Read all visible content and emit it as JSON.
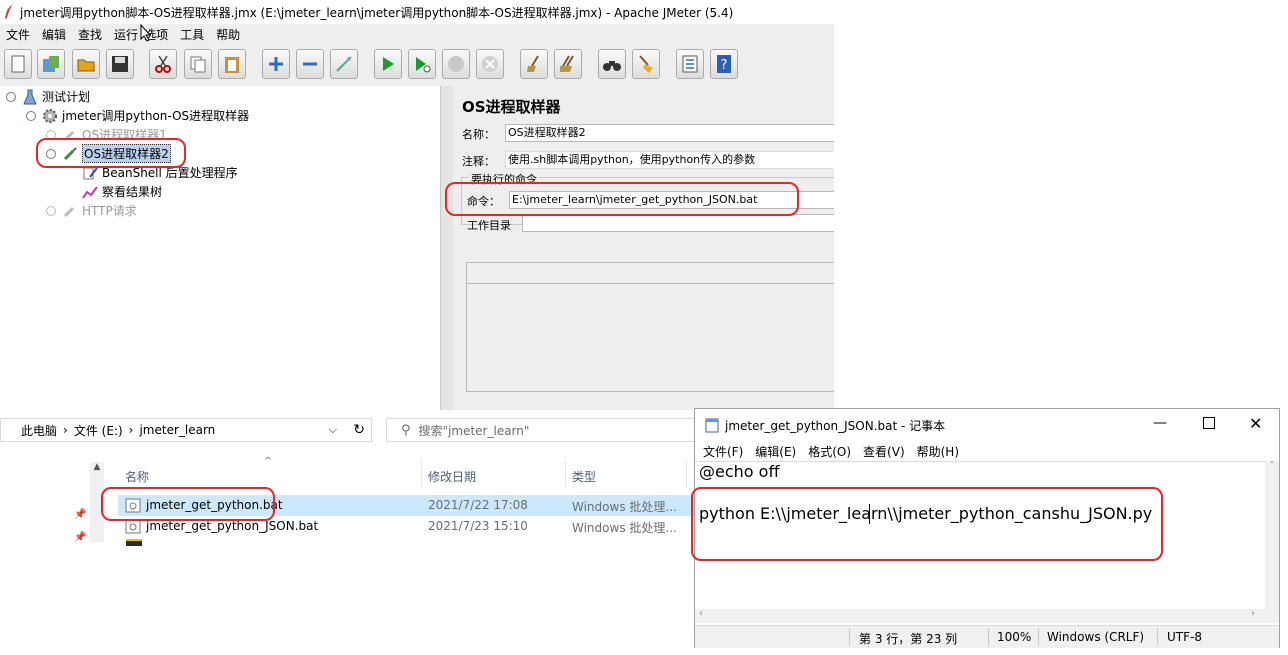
{
  "jmeter": {
    "title": "jmeter调用python脚本-OS进程取样器.jmx (E:\\jmeter_learn\\jmeter调用python脚本-OS进程取样器.jmx) - Apache JMeter (5.4)",
    "menu": [
      "文件",
      "编辑",
      "查找",
      "运行",
      "选项",
      "工具",
      "帮助"
    ],
    "tree": {
      "test_plan": "测试计划",
      "thread_group": "jmeter调用python-OS进程取样器",
      "os_sampler_1": "OS进程取样器1",
      "os_sampler_2": "OS进程取样器2",
      "beanshell": "BeanShell 后置处理程序",
      "result_tree": "察看结果树",
      "http": "HTTP请求"
    },
    "panel": {
      "heading": "OS进程取样器",
      "name_label": "名称：",
      "name_value": "OS进程取样器2",
      "comment_label": "注释：",
      "comment_value": "使用.sh脚本调用python，使用python传入的参数",
      "section_label": "要执行的命令",
      "command_label": "命令：",
      "command_value": "E:\\jmeter_learn\\jmeter_get_python_JSON.bat",
      "workdir_label": "工作目录",
      "workdir_value": ""
    }
  },
  "explorer": {
    "breadcrumb": [
      "此电脑",
      "文件 (E:)",
      "jmeter_learn"
    ],
    "search_placeholder": "搜索\"jmeter_learn\"",
    "columns": {
      "name": "名称",
      "modified": "修改日期",
      "type": "类型"
    },
    "files": [
      {
        "name": "jmeter_get_python.bat",
        "modified": "2021/7/22 17:08",
        "type": "Windows 批处理..."
      },
      {
        "name": "jmeter_get_python_JSON.bat",
        "modified": "2021/7/23 15:10",
        "type": "Windows 批处理..."
      }
    ]
  },
  "notepad": {
    "title": "jmeter_get_python_JSON.bat - 记事本",
    "menu": [
      "文件(F)",
      "编辑(E)",
      "格式(O)",
      "查看(V)",
      "帮助(H)"
    ],
    "lines": [
      "@echo off",
      "",
      "python E:\\\\jmeter_learn\\\\jmeter_python_canshu_JSON.py"
    ],
    "status": {
      "position": "第 3 行，第 23 列",
      "zoom": "100%",
      "eol": "Windows (CRLF)",
      "encoding": "UTF-8"
    }
  }
}
